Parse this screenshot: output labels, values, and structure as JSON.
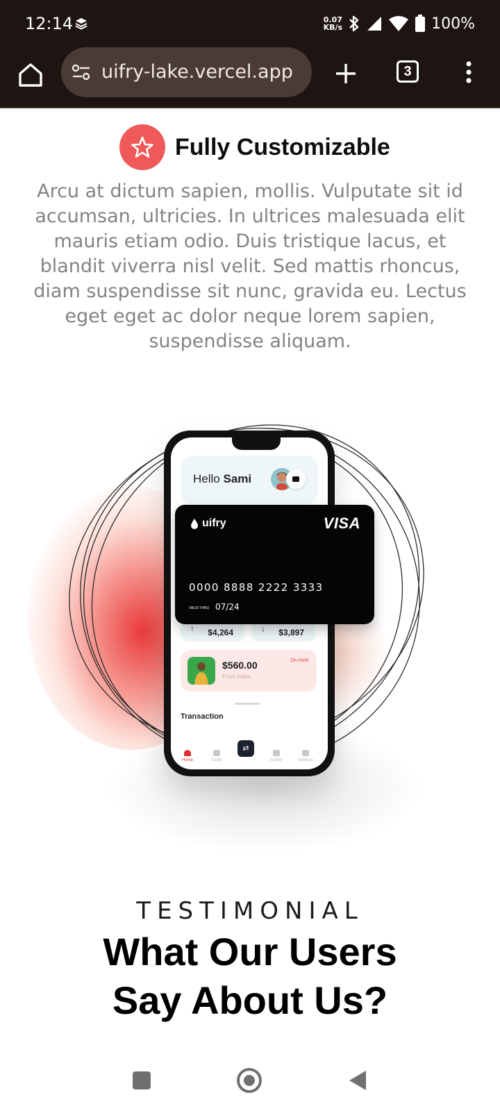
{
  "status_bar": {
    "time": "12:14",
    "net_speed_value": "0.07",
    "net_speed_unit": "KB/s",
    "battery": "100%",
    "icons": [
      "layers-icon",
      "bluetooth-icon",
      "signal-icon",
      "wifi-icon",
      "battery-icon"
    ]
  },
  "browser": {
    "url": "uifry-lake.vercel.app",
    "tab_count": "3",
    "icons": [
      "home-icon",
      "site-settings-icon",
      "plus-icon",
      "tabs-icon",
      "more-vert-icon"
    ]
  },
  "feature": {
    "title": "Fully Customizable",
    "description": "Arcu at dictum sapien, mollis. Vulputate sit id accumsan, ultricies. In ultrices malesuada elit mauris etiam odio. Duis tristique lacus, et blandit viverra nisl velit. Sed mattis rhoncus, diam suspendisse sit nunc, gravida eu. Lectus eget eget ac dolor neque lorem sapien, suspendisse aliquam.",
    "icon": "star-icon",
    "accent_color": "#f0595a"
  },
  "mockup": {
    "greeting": "Hello",
    "name": "Sami",
    "card_brand": "uifry",
    "card_network": "VISA",
    "card_number": "0000 8888 2222 3333",
    "valid_label": "VALID THRU",
    "valid_thru": "07/24",
    "income": "$4,264",
    "expense": "$3,897",
    "payment_amount": "$560.00",
    "payment_from": "From Adam",
    "payment_status": "On Hold",
    "transactions_label": "Transaction",
    "nav": {
      "home": "Home",
      "cards": "Cards",
      "activity": "Activity",
      "settings": "Settings"
    }
  },
  "testimonial": {
    "eyebrow": "TESTIMONIAL",
    "heading_line1": "What Our Users",
    "heading_line2": "Say About Us?"
  },
  "system_nav": {
    "icons": [
      "recents-icon",
      "home-icon",
      "back-icon"
    ]
  }
}
